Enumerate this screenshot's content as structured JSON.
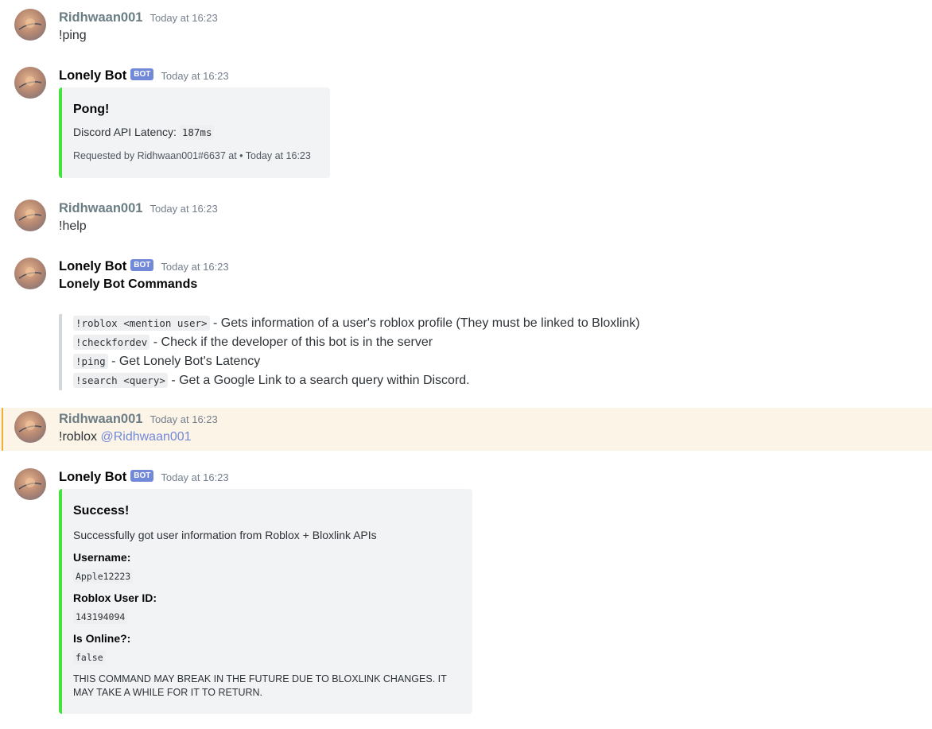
{
  "messages": [
    {
      "author": "Ridhwaan001",
      "timestamp": "Today at 16:23",
      "text": "!ping"
    },
    {
      "author": "Lonely Bot",
      "bot_tag": "BOT",
      "timestamp": "Today at 16:23",
      "embed": {
        "title": "Pong!",
        "description_prefix": "Discord API Latency: ",
        "latency_code": "187ms",
        "footer": "Requested by Ridhwaan001#6637 at • Today at 16:23",
        "accent_color": "#43e33b"
      }
    },
    {
      "author": "Ridhwaan001",
      "timestamp": "Today at 16:23",
      "text": "!help"
    },
    {
      "author": "Lonely Bot",
      "bot_tag": "BOT",
      "timestamp": "Today at 16:23",
      "heading": "Lonely Bot Commands",
      "commands": [
        {
          "code": "!roblox <mention user>",
          "desc": " - Gets information of a user's roblox profile (They must be linked to Bloxlink)"
        },
        {
          "code": "!checkfordev",
          "desc": " - Check if the developer of this bot is in the server"
        },
        {
          "code": "!ping",
          "desc": " - Get Lonely Bot's Latency"
        },
        {
          "code": "!search <query>",
          "desc": " - Get a Google Link to a search query within Discord."
        }
      ]
    },
    {
      "author": "Ridhwaan001",
      "timestamp": "Today at 16:23",
      "text": "!roblox ",
      "mention": "@Ridhwaan001",
      "highlighted": true
    },
    {
      "author": "Lonely Bot",
      "bot_tag": "BOT",
      "timestamp": "Today at 16:23",
      "embed": {
        "title": "Success!",
        "description": "Successfully got user information from Roblox + Bloxlink APIs",
        "fields": [
          {
            "name": "Username:",
            "value": "Apple12223"
          },
          {
            "name": "Roblox User ID:",
            "value": "143194094"
          },
          {
            "name": "Is Online?:",
            "value": "false"
          }
        ],
        "notice": "THIS COMMAND MAY BREAK IN THE FUTURE DUE TO BLOXLINK CHANGES. IT MAY TAKE A WHILE FOR IT TO RETURN.",
        "accent_color": "#43e33b"
      }
    }
  ],
  "colors": {
    "user_name": "#6b7d85",
    "bot_tag_bg": "#7289da",
    "mention": "#7289da",
    "highlight_bg": "#fdf4e8",
    "highlight_bar": "#f0b132",
    "embed_bg": "#f2f3f5"
  }
}
